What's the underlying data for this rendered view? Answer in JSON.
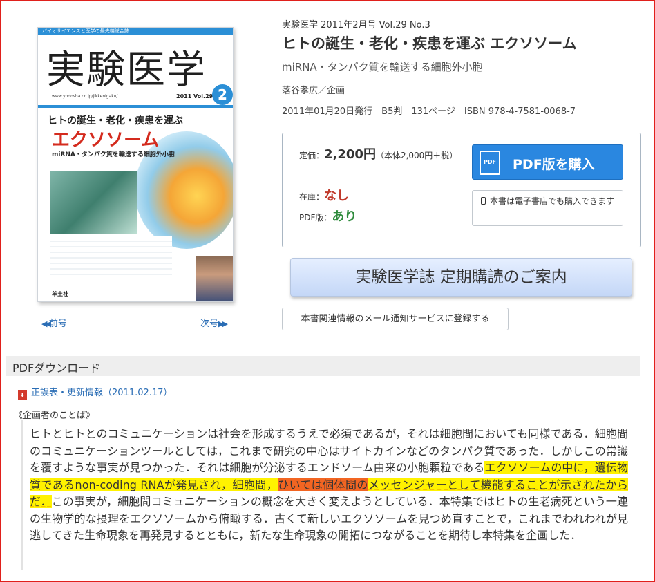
{
  "cover": {
    "top_text": "バイオサイエンスと医学の最先端総合誌",
    "logo": "実験医学",
    "url": "www.yodosha.co.jp/jikkenigaku/",
    "year": "2011 Vol.29 No.3",
    "number": "2",
    "title_line1": "ヒトの誕生・老化・疾患を運ぶ",
    "title_line2": "エクソソーム",
    "title_line3": "miRNA・タンパク質を輸送する細胞外小胞",
    "publisher": "羊土社"
  },
  "nav": {
    "prev": "前号",
    "next": "次号"
  },
  "book": {
    "issue": "実験医学 2011年2月号 Vol.29 No.3",
    "title": "ヒトの誕生・老化・疾患を運ぶ エクソソーム",
    "subtitle": "miRNA・タンパク質を輸送する細胞外小胞",
    "editor": "落谷孝広／企画",
    "meta": "2011年01月20日発行　B5判　131ページ　ISBN 978-4-7581-0068-7"
  },
  "price": {
    "label": "定価：",
    "value": "2,200円",
    "note": "（本体2,000円＋税）",
    "stock_label": "在庫：",
    "stock_value": "なし",
    "pdf_label": "PDF版：",
    "pdf_value": "あり"
  },
  "buttons": {
    "buy_pdf": "PDF版を購入",
    "buy_pdf_icon": "PDF",
    "ebook": "本書は電子書店でも購入できます",
    "subscription": "実験医学誌 定期購読のご案内",
    "mail": "本書関連情報のメール通知サービスに登録する"
  },
  "pdf_section": {
    "heading": "PDFダウンロード",
    "errata": "正誤表・更新情報（2011.02.17）"
  },
  "intro": {
    "heading": "《企画者のことば》",
    "p1": "ヒトとヒトとのコミュニケーションは社会を形成するうえで必須であるが，それは細胞間においても同様である．細胞間のコミュニケーションツールとしては，これまで研究の中心はサイトカインなどのタンパク質であった．しかしこの常識を覆すような事実が見つかった．それは細胞が分泌するエンドソーム由来の小胞顆粒である",
    "hl1": "エクソソームの中に，遺伝物質であるnon-coding RNAが発見され，細胞間，",
    "hl2": "ひいては個体間の",
    "hl3": "メッセンジャーとして機能することが示されたからだ．",
    "p2": "この事実が，細胞間コミュニケーションの概念を大きく変えようとしている．本特集ではヒトの生老病死という一連の生物学的な摂理をエクソソームから俯瞰する．古くて新しいエクソソームを見つめ直すことで，これまでわれわれが見逃してきた生命現象を再発見するとともに，新たな生命現象の開拓につながることを期待し本特集を企画した．"
  },
  "colors": {
    "accent_blue": "#2a87e0",
    "link": "#2a6db5",
    "stock_red": "#c0392b",
    "pdf_green": "#2e8b3c",
    "highlight_yellow": "#fff200",
    "highlight_orange": "#f26522",
    "frame_red": "#e0201c"
  }
}
